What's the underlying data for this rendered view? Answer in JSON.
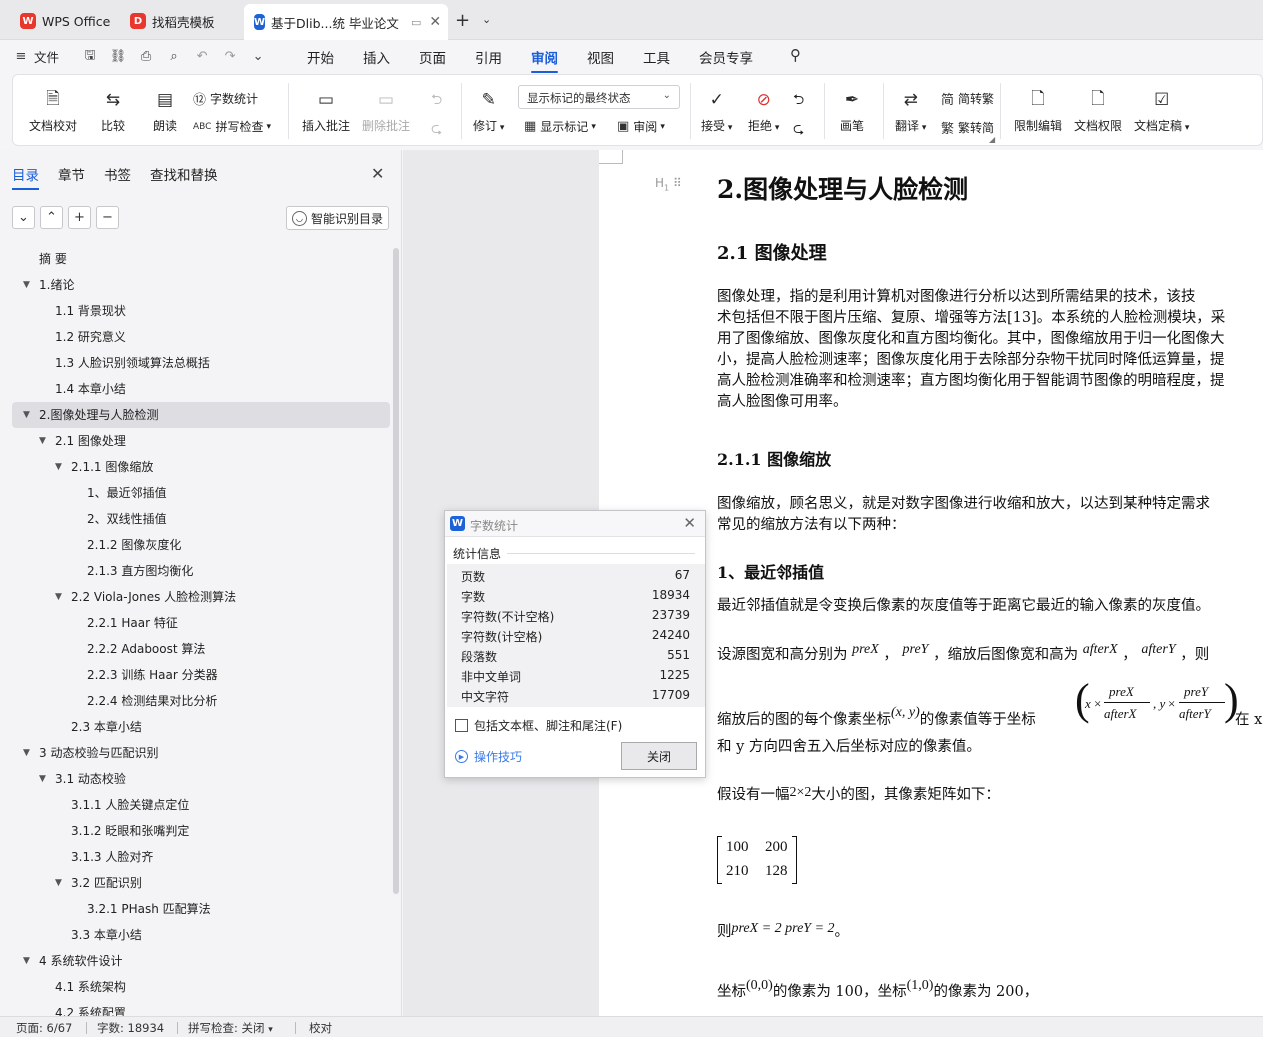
{
  "tabs": [
    {
      "label": "WPS Office",
      "icon": "wps-logo-icon",
      "color": "#e8372c"
    },
    {
      "label": "找稻壳模板",
      "icon": "docer-logo-icon",
      "color": "#e8372c"
    },
    {
      "label": "基于Dlib...统 毕业论文",
      "icon": "wps-writer-icon",
      "color": "#1d62d6"
    }
  ],
  "menu": {
    "file": "文件",
    "tabs": [
      "开始",
      "插入",
      "页面",
      "引用",
      "审阅",
      "视图",
      "工具",
      "会员专享"
    ],
    "active": "审阅"
  },
  "ribbon": {
    "proofread": "文档校对",
    "compare": "比较",
    "read_aloud": "朗读",
    "word_count": "字数统计",
    "spell_check": "拼写检查",
    "insert_comment": "插入批注",
    "delete_comment": "删除批注",
    "track_changes": "修订",
    "markup_state": "显示标记的最终状态",
    "show_markup": "显示标记",
    "review_pane": "审阅",
    "accept": "接受",
    "reject": "拒绝",
    "pen": "画笔",
    "translate": "翻译",
    "to_traditional": "简转繁",
    "to_simplified": "繁转简",
    "restrict_edit": "限制编辑",
    "doc_permission": "文档权限",
    "finalize": "文档定稿"
  },
  "nav": {
    "tabs": [
      "目录",
      "章节",
      "书签",
      "查找和替换"
    ],
    "smart_toc": "智能识别目录",
    "toc": [
      {
        "label": "摘 要",
        "level": 0,
        "toggle": false
      },
      {
        "label": "1.绪论",
        "level": 0,
        "toggle": true
      },
      {
        "label": "1.1 背景现状",
        "level": 1,
        "toggle": false
      },
      {
        "label": "1.2  研究意义",
        "level": 1,
        "toggle": false
      },
      {
        "label": "1.3 人脸识别领域算法总概括",
        "level": 1,
        "toggle": false
      },
      {
        "label": "1.4 本章小结",
        "level": 1,
        "toggle": false
      },
      {
        "label": "2.图像处理与人脸检测",
        "level": 0,
        "toggle": true,
        "selected": true
      },
      {
        "label": "2.1 图像处理",
        "level": 1,
        "toggle": true
      },
      {
        "label": "2.1.1 图像缩放",
        "level": 2,
        "toggle": true
      },
      {
        "label": "1、最近邻插值",
        "level": 3,
        "toggle": false
      },
      {
        "label": "2、双线性插值",
        "level": 3,
        "toggle": false
      },
      {
        "label": "2.1.2 图像灰度化",
        "level": 3,
        "toggle": false
      },
      {
        "label": "2.1.3 直方图均衡化",
        "level": 3,
        "toggle": false
      },
      {
        "label": "2.2 Viola-Jones 人脸检测算法",
        "level": 2,
        "toggle": true
      },
      {
        "label": "2.2.1 Haar 特征",
        "level": 3,
        "toggle": false
      },
      {
        "label": "2.2.2 Adaboost 算法",
        "level": 3,
        "toggle": false
      },
      {
        "label": "2.2.3  训练 Haar 分类器",
        "level": 3,
        "toggle": false
      },
      {
        "label": "2.2.4 检测结果对比分析",
        "level": 3,
        "toggle": false
      },
      {
        "label": "2.3  本章小结",
        "level": 2,
        "toggle": false
      },
      {
        "label": "3 动态校验与匹配识别",
        "level": 0,
        "toggle": true
      },
      {
        "label": "3.1  动态校验",
        "level": 1,
        "toggle": true
      },
      {
        "label": "3.1.1 人脸关键点定位",
        "level": 2,
        "toggle": false
      },
      {
        "label": "3.1.2 眨眼和张嘴判定",
        "level": 2,
        "toggle": false
      },
      {
        "label": "3.1.3  人脸对齐",
        "level": 2,
        "toggle": false
      },
      {
        "label": "3.2  匹配识别",
        "level": 2,
        "toggle": true
      },
      {
        "label": "3.2.1 PHash 匹配算法",
        "level": 3,
        "toggle": false
      },
      {
        "label": "3.3  本章小结",
        "level": 2,
        "toggle": false
      },
      {
        "label": "4 系统软件设计",
        "level": 0,
        "toggle": true
      },
      {
        "label": "4.1 系统架构",
        "level": 1,
        "toggle": false
      },
      {
        "label": "4.2 系统配置",
        "level": 1,
        "toggle": false
      }
    ]
  },
  "document": {
    "h1": "2.图像处理与人脸检测",
    "h2": "2.1 图像处理",
    "p1": [
      "    图像处理，指的是利用计算机对图像进行分析以达到所需结果的技术，该技",
      "术包括但不限于图片压缩、复原、增强等方法[13]。本系统的人脸检测模块，采",
      "用了图像缩放、图像灰度化和直方图均衡化。其中，图像缩放用于归一化图像大",
      "小，提高人脸检测速率；图像灰度化用于去除部分杂物干扰同时降低运算量，提",
      "高人脸检测准确率和检测速率；直方图均衡化用于智能调节图像的明暗程度，提",
      "高人脸图像可用率。"
    ],
    "h3": "2.1.1 图像缩放",
    "p2": [
      "图像缩放，顾名思义，就是对数字图像进行收缩和放大，以达到某种特定需求",
      "常见的缩放方法有以下两种："
    ],
    "h4": "1、最近邻插值",
    "p3": "最近邻插值就是令变换后像素的灰度值等于距离它最近的输入像素的灰度值。",
    "p4_a": "设源图宽和高分别为",
    "p4_b": "，",
    "p4_c": "，缩放后图像宽和高为",
    "p4_d": "，",
    "p4_e": "，则",
    "m_prex": "preX",
    "m_prey": "preY",
    "m_afterx": "afterX",
    "m_aftery": "afterY",
    "p5_a": "缩放后的图的每个像素坐标",
    "m_xy": "(x, y)",
    "p5_b": "的像素值等于坐标",
    "m_x": "x",
    "m_times": "×",
    "m_comma": ", y",
    "p5_c": "在 x",
    "p6": "和 y 方向四舍五入后坐标对应的像素值。",
    "p7_a": "假设有一幅",
    "m_2x2": "2×2",
    "p7_b": "大小的图，其像素矩阵如下：",
    "matrix": [
      [
        "100",
        "200"
      ],
      [
        "210",
        "128"
      ]
    ],
    "p8_a": "则",
    "m_eq": "preX = 2  preY = 2",
    "p8_b": "。",
    "p9_a": "坐标",
    "m_00": "(0,0)",
    "p9_b": "的像素为 100，坐标",
    "m_10": "(1,0)",
    "p9_c": "的像素为 200，"
  },
  "word_count_dialog": {
    "title": "字数统计",
    "section": "统计信息",
    "rows": [
      {
        "label": "页数",
        "value": "67"
      },
      {
        "label": "字数",
        "value": "18934"
      },
      {
        "label": "字符数(不计空格)",
        "value": "23739"
      },
      {
        "label": "字符数(计空格)",
        "value": "24240"
      },
      {
        "label": "段落数",
        "value": "551"
      },
      {
        "label": "非中文单词",
        "value": "1225"
      },
      {
        "label": "中文字符",
        "value": "17709"
      }
    ],
    "checkbox": "包括文本框、脚注和尾注(F)",
    "tips": "操作技巧",
    "close": "关闭"
  },
  "status": {
    "page": "页面: 6/67",
    "words": "字数: 18934",
    "spell": "拼写检查: 关闭",
    "proof": "校对"
  }
}
